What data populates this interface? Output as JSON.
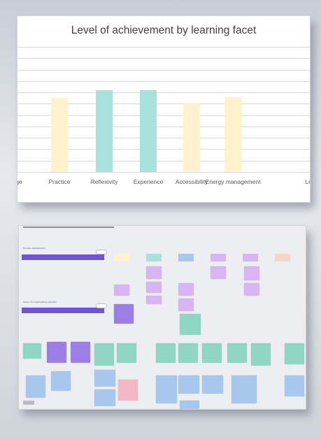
{
  "chart": {
    "title": "Level of achievement by learning facet",
    "colors": {
      "yellow": "#fff2cc",
      "teal": "#a8e2dc",
      "grid": "#d9d9d9"
    },
    "chart_data": {
      "type": "bar",
      "title": "Level of achievement by learning facet",
      "categories": [
        "ge",
        "Practice",
        "Reflexivity",
        "Experience",
        "Accessibility",
        "Energy management",
        "Le"
      ],
      "values": [
        null,
        6.5,
        7.2,
        7.2,
        6.1,
        6.6,
        null
      ],
      "bar_colors": [
        "",
        "#fff2cc",
        "#a8e2dc",
        "#a8e2dc",
        "#fff2cc",
        "#fff2cc",
        ""
      ],
      "ylim": [
        0,
        11
      ],
      "grid": true,
      "xlabel": "",
      "ylabel": ""
    }
  },
  "board": {
    "section1_title": "Problem identification",
    "section2_title": "Sense of unmet/met/key activities",
    "colors": {
      "purple": "#9b7ee6",
      "lilac": "#d8b4f5",
      "teal": "#8fd6c5",
      "blue": "#a7c7ee",
      "pink": "#f2b8c6",
      "band": "#6d55d6",
      "bg": "#eceef2"
    }
  }
}
